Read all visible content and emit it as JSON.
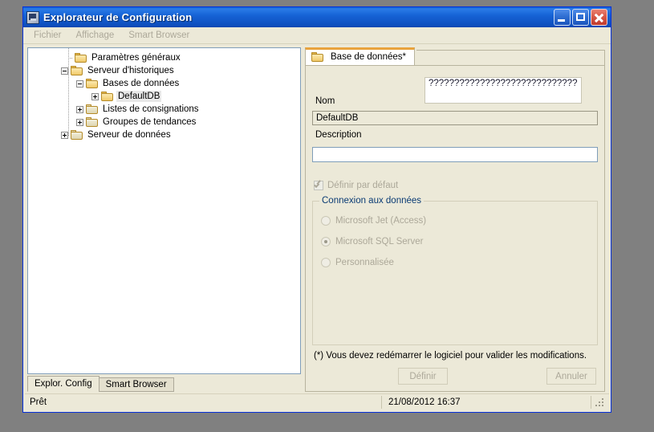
{
  "window": {
    "title": "Explorateur de Configuration",
    "icon": "app-icon",
    "buttons": {
      "minimize": "_",
      "maximize": "□",
      "close": "✕"
    }
  },
  "menubar": {
    "items": [
      {
        "label": "Fichier"
      },
      {
        "label": "Affichage"
      },
      {
        "label": "Smart Browser"
      }
    ]
  },
  "tree": {
    "nodes": [
      {
        "label": "Paramètres généraux",
        "depth": 1,
        "expander": "none",
        "selected": false
      },
      {
        "label": "Serveur d'historiques",
        "depth": 1,
        "expander": "minus",
        "selected": false
      },
      {
        "label": "Bases de données",
        "depth": 2,
        "expander": "minus",
        "selected": false
      },
      {
        "label": "DefaultDB",
        "depth": 3,
        "expander": "plus",
        "selected": true
      },
      {
        "label": "Listes de consignations",
        "depth": 2,
        "expander": "plus",
        "selected": false
      },
      {
        "label": "Groupes de tendances",
        "depth": 2,
        "expander": "plus",
        "selected": false
      },
      {
        "label": "Serveur de données",
        "depth": 1,
        "expander": "plus",
        "selected": false
      }
    ]
  },
  "left_tabs": [
    {
      "label": "Explor. Config",
      "active": true
    },
    {
      "label": "Smart Browser",
      "active": false
    }
  ],
  "right_panel": {
    "tab": {
      "label": "Base de données*",
      "icon": "folder-icon"
    },
    "tooltip": {
      "text": "?????????????????????????????"
    },
    "nom": {
      "label": "Nom",
      "value": "DefaultDB"
    },
    "description": {
      "label": "Description",
      "value": "",
      "placeholder": ""
    },
    "default_checkbox": {
      "label": "Définir par défaut",
      "checked": true,
      "disabled": true
    },
    "group": {
      "title": "Connexion aux données",
      "options": [
        {
          "label": "Microsoft Jet (Access)",
          "selected": false
        },
        {
          "label": "Microsoft SQL Server",
          "selected": true
        },
        {
          "label": "Personnalisée",
          "selected": false
        }
      ]
    },
    "note": "(*) Vous devez redémarrer le logiciel pour valider les modifications.",
    "buttons": [
      {
        "label": "Définir",
        "disabled": true
      },
      {
        "label": "Annuler",
        "disabled": true
      }
    ]
  },
  "statusbar": {
    "message": "Prêt",
    "datetime": "21/08/2012 16:37"
  },
  "colors": {
    "titlebar": "#0A5FD4",
    "panel": "#ECE9D8",
    "desktop": "#808080",
    "tab_accent": "#E8A33D",
    "group_title": "#0A3B74",
    "disabled_text": "#ACA899"
  }
}
